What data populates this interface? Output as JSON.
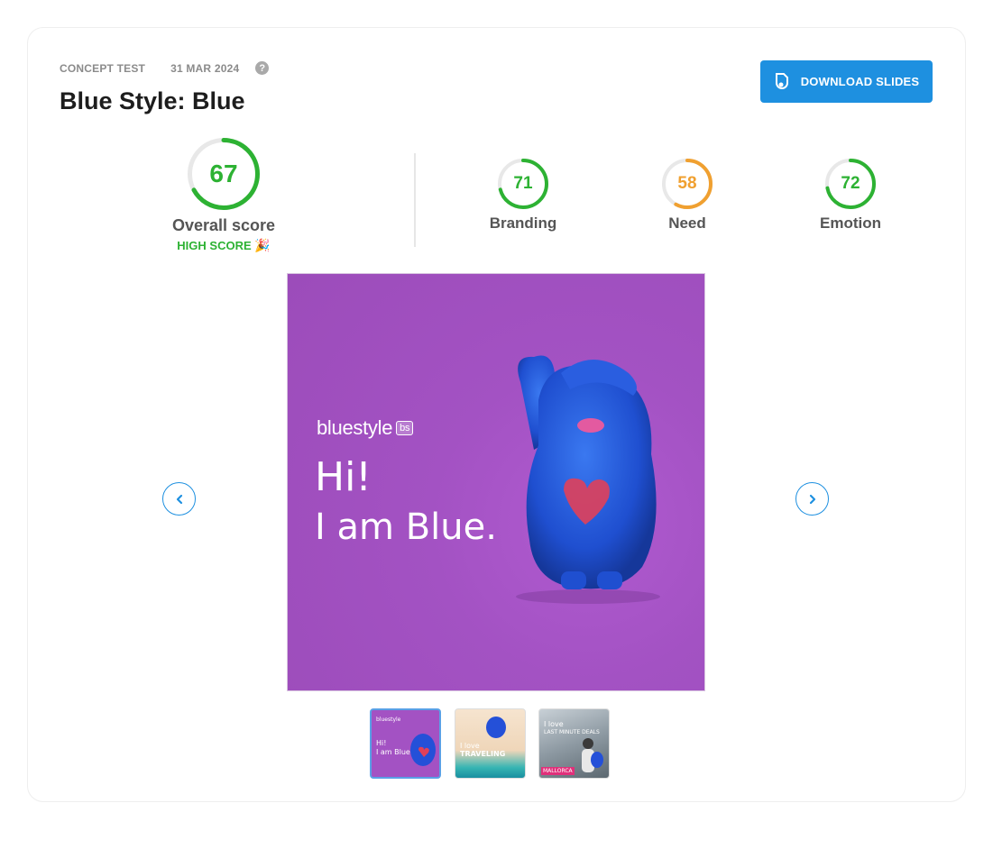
{
  "header": {
    "category": "CONCEPT TEST",
    "date": "31 MAR 2024",
    "help": "?",
    "title": "Blue Style: Blue"
  },
  "actions": {
    "download_label": "DOWNLOAD SLIDES"
  },
  "scores": {
    "overall": {
      "value": 67,
      "label": "Overall score",
      "badge": "HIGH SCORE",
      "badge_emoji": "🎉",
      "color": "#2db233"
    },
    "metrics": [
      {
        "key": "branding",
        "value": 71,
        "label": "Branding",
        "color": "#2db233"
      },
      {
        "key": "need",
        "value": 58,
        "label": "Need",
        "color": "#f0a030"
      },
      {
        "key": "emotion",
        "value": 72,
        "label": "Emotion",
        "color": "#2db233"
      }
    ]
  },
  "slide": {
    "brand": "bluestyle",
    "brand_badge": "bs",
    "line1": "Hi!",
    "line2": "I am Blue."
  },
  "thumbnails": [
    {
      "lines": [
        "bluestyle",
        "Hi!",
        "I am Blue."
      ],
      "selected": true
    },
    {
      "lines": [
        "I love",
        "TRAVELING"
      ],
      "selected": false
    },
    {
      "lines": [
        "I love",
        "LAST MINUTE DEALS",
        "MALLORCA"
      ],
      "selected": false
    }
  ],
  "colors": {
    "accent": "#1e90e0",
    "good": "#2db233",
    "medium": "#f0a030",
    "track": "#e8e8e8",
    "slide_bg": "#a352c3"
  }
}
